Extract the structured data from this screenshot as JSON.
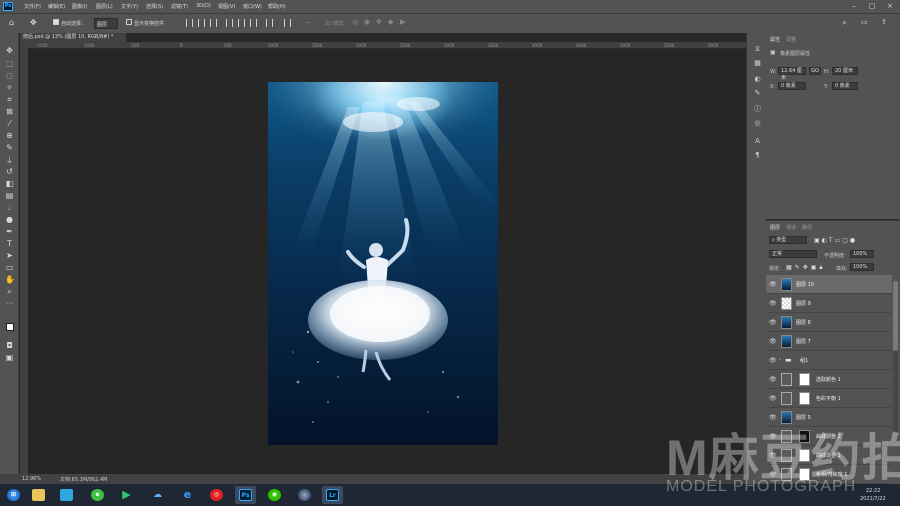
{
  "menu": {
    "items": [
      "文件(F)",
      "编辑(E)",
      "图像(I)",
      "图层(L)",
      "文字(Y)",
      "选择(S)",
      "滤镜(T)",
      "3D(D)",
      "视图(V)",
      "窗口(W)",
      "帮助(H)"
    ],
    "app_icon": "Ps"
  },
  "options": {
    "auto_select_label": "自动选择：",
    "auto_select_value": "图层",
    "show_transform_label": "显示变换控件",
    "mode_3d_label": "3D 模式："
  },
  "document": {
    "tab_title": "修后.psd @ 13% (图层 10, RGB/8#) *",
    "ruler_ticks": [
      "-1500",
      "-1000",
      "-500",
      "0",
      "500",
      "1000",
      "1500",
      "2000",
      "2500",
      "3000",
      "3500",
      "4000",
      "4500",
      "5000",
      "5500",
      "6000"
    ]
  },
  "status": {
    "zoom": "12.96%",
    "doc_size": "文档:65.3M/862.4M"
  },
  "properties": {
    "tabs": [
      "属性",
      "调整"
    ],
    "heading": "像素图层属性",
    "w_label": "W:",
    "w_value": "12.64 厘米",
    "link_label": "GO",
    "h_label": "H:",
    "h_value": "20 厘米",
    "x_label": "X:",
    "x_value": "0 像素",
    "y_label": "Y:",
    "y_value": "0 像素"
  },
  "layers_panel": {
    "tabs": [
      "图层",
      "通道",
      "路径"
    ],
    "filter_label": "类型",
    "blend_mode": "正常",
    "opacity_label": "不透明度:",
    "opacity_value": "100%",
    "lock_label": "锁定:",
    "fill_label": "填充:",
    "fill_value": "100%",
    "layers": [
      {
        "name": "图层 10",
        "thumb": "photo",
        "selected": true
      },
      {
        "name": "图层 9",
        "thumb": "empty",
        "selected": false
      },
      {
        "name": "图层 8",
        "thumb": "photo",
        "selected": false
      },
      {
        "name": "图层 7",
        "thumb": "photo",
        "selected": false
      },
      {
        "name": "组1",
        "thumb": "folder",
        "selected": false
      },
      {
        "name": "选取颜色 1",
        "thumb": "adj",
        "selected": false
      },
      {
        "name": "色彩平衡 1",
        "thumb": "adj",
        "selected": false
      },
      {
        "name": "图层 5",
        "thumb": "photo",
        "selected": false
      },
      {
        "name": "曲线调整 2",
        "thumb": "adj",
        "selected": false
      },
      {
        "name": "曲线调整 1",
        "thumb": "adj",
        "selected": false
      },
      {
        "name": "色相/饱和度 1",
        "thumb": "adj",
        "selected": false
      }
    ]
  },
  "taskbar": {
    "clock_time": "22:22",
    "clock_date": "2021/7/22",
    "apps": [
      "start",
      "explorer",
      "store",
      "360",
      "media",
      "baidu",
      "ie",
      "netease",
      "ps",
      "wechat",
      "camera",
      "lr"
    ]
  },
  "watermark": {
    "brand_cn": "M麻豆约拍",
    "brand_en": "MODEL PHOTOGRAPH"
  },
  "colors": {
    "ui_dark": "#282828",
    "ui_panel": "#535353",
    "ps_blue": "#31a8ff",
    "taskbar": "#1e2733"
  }
}
